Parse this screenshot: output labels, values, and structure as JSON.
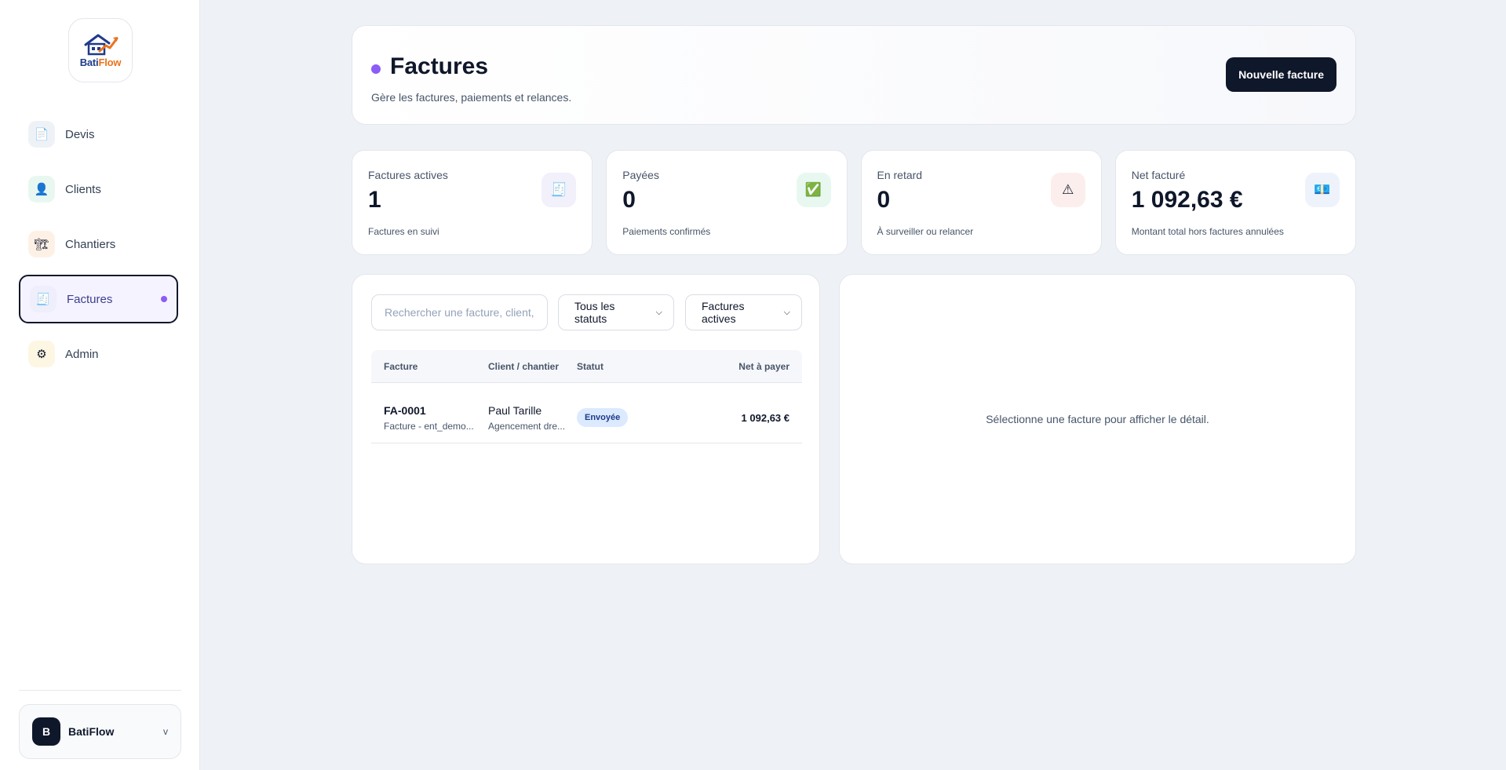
{
  "brand": {
    "part1": "Bati",
    "part2": "Flow",
    "colors": {
      "blue": "#1f3b8a",
      "orange": "#e8731f"
    }
  },
  "sidebar": {
    "items": [
      {
        "label": "Devis",
        "icon": "document-icon",
        "glyph": "📄",
        "bg": "#eef2f7"
      },
      {
        "label": "Clients",
        "icon": "user-icon",
        "glyph": "👤",
        "bg": "#e8f8f1"
      },
      {
        "label": "Chantiers",
        "icon": "crane-icon",
        "glyph": "🏗",
        "bg": "#fdf1e6"
      },
      {
        "label": "Factures",
        "icon": "invoice-icon",
        "glyph": "🧾",
        "bg": "#efeefb",
        "active": true
      },
      {
        "label": "Admin",
        "icon": "gear-icon",
        "glyph": "⚙",
        "bg": "#fdf6e3"
      }
    ],
    "user": {
      "initial": "B",
      "name": "BatiFlow",
      "chevron": "v"
    }
  },
  "header": {
    "title": "Factures",
    "subtitle": "Gère les factures, paiements et relances.",
    "new_button": "Nouvelle facture",
    "accent": "#8b5cf6"
  },
  "stats": [
    {
      "title": "Factures actives",
      "value": "1",
      "desc": "Factures en suivi",
      "icon": "invoice-icon",
      "glyph": "🧾",
      "bg": "#f1f0fb"
    },
    {
      "title": "Payées",
      "value": "0",
      "desc": "Paiements confirmés",
      "icon": "check-icon",
      "glyph": "✅",
      "bg": "#e8f8f1"
    },
    {
      "title": "En retard",
      "value": "0",
      "desc": "À surveiller ou relancer",
      "icon": "warning-icon",
      "glyph": "⚠",
      "bg": "#fdeeee"
    },
    {
      "title": "Net facturé",
      "value": "1 092,63 €",
      "desc": "Montant total hors factures annulées",
      "icon": "money-icon",
      "glyph": "💶",
      "bg": "#eef3fb"
    }
  ],
  "filters": {
    "search_placeholder": "Rechercher une facture, client,",
    "status_select": "Tous les statuts",
    "scope_select": "Factures actives"
  },
  "table": {
    "headers": {
      "facture": "Facture",
      "client": "Client / chantier",
      "statut": "Statut",
      "net": "Net à payer"
    },
    "rows": [
      {
        "id": "FA-0001",
        "subtitle": "Facture - ent_demo...",
        "client": "Paul Tarille",
        "chantier": "Agencement dre...",
        "status": "Envoyée",
        "amount": "1 092,63 €"
      }
    ]
  },
  "detail": {
    "empty_text": "Sélectionne une facture pour afficher le détail."
  }
}
